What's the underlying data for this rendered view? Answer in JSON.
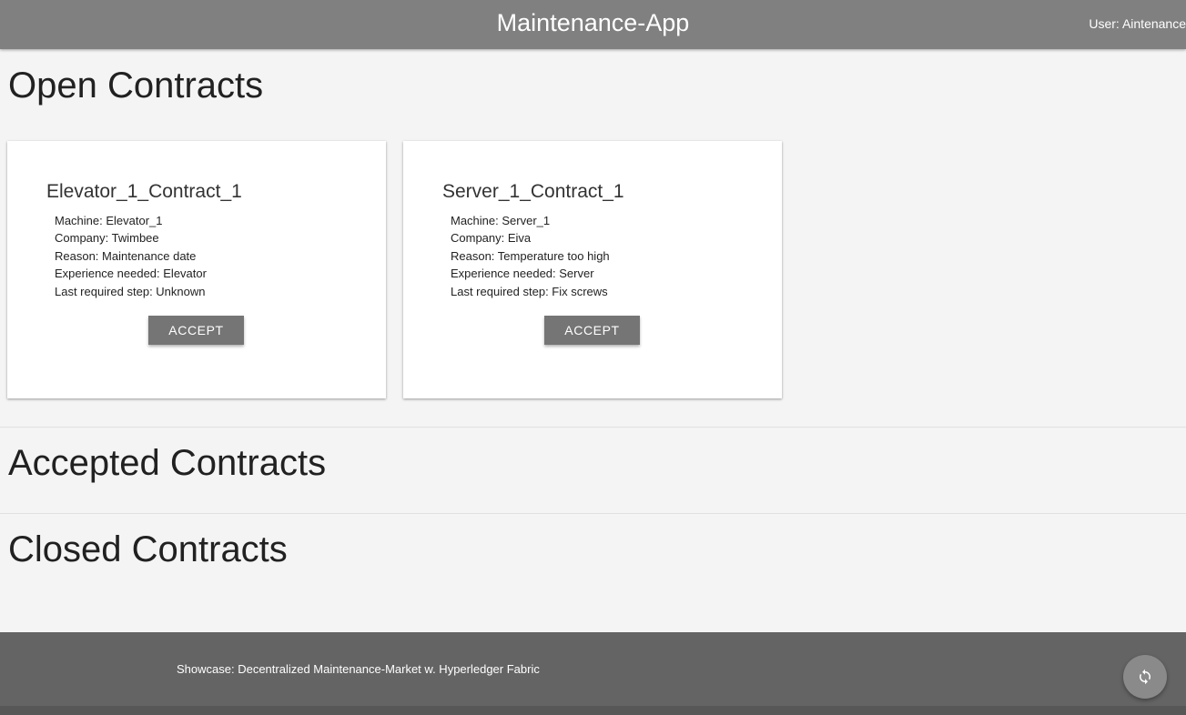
{
  "header": {
    "title": "Maintenance-App",
    "user": "User: Aintenance"
  },
  "sections": {
    "open": "Open Contracts",
    "accepted": "Accepted Contracts",
    "closed": "Closed Contracts"
  },
  "open_contracts": [
    {
      "title": "Elevator_1_Contract_1",
      "machine": "Machine: Elevator_1",
      "company": "Company: Twimbee",
      "reason": "Reason: Maintenance date",
      "experience": "Experience needed: Elevator",
      "last_step": "Last required step: Unknown",
      "button": "ACCEPT"
    },
    {
      "title": "Server_1_Contract_1",
      "machine": "Machine: Server_1",
      "company": "Company: Eiva",
      "reason": "Reason: Temperature too high",
      "experience": "Experience needed: Server",
      "last_step": "Last required step: Fix screws",
      "button": "ACCEPT"
    }
  ],
  "footer": {
    "text": "Showcase: Decentralized Maintenance-Market w. Hyperledger Fabric",
    "refresh_icon": "refresh-icon"
  },
  "colors": {
    "header_bg": "#808080",
    "button_bg": "#757575",
    "footer_bg": "#646464",
    "page_bg": "#f4f4f4"
  }
}
